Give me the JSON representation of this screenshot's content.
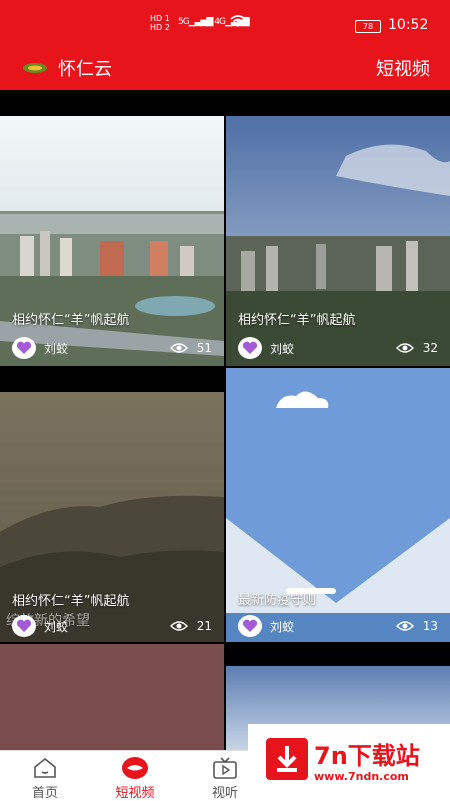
{
  "status_bar": {
    "signal_text_1": "HD 1",
    "signal_text_2": "HD 2",
    "network": "5G",
    "network2": "4G",
    "battery": "78",
    "time": "10:52"
  },
  "header": {
    "app_title": "怀仁云",
    "section_title": "短视频",
    "accent_color": "#e8141c"
  },
  "videos": [
    {
      "caption": "相约怀仁“羊”帆起航",
      "author": "刘蛟",
      "views": "51",
      "avatar_icon": "heart-icon"
    },
    {
      "caption": "相约怀仁“羊”帆起航",
      "author": "刘蛟",
      "views": "32",
      "avatar_icon": "heart-icon"
    },
    {
      "caption": "相约怀仁“羊”帆起航",
      "author": "刘蛟",
      "views": "21",
      "overlay": "绽放新的希望",
      "avatar_icon": "heart-icon"
    },
    {
      "caption": "最新防疫守则",
      "author": "刘蛟",
      "views": "13",
      "avatar_icon": "heart-icon"
    }
  ],
  "bottom_nav": [
    {
      "label": "首页",
      "icon": "home-icon"
    },
    {
      "label": "短视频",
      "icon": "lips-icon",
      "active": true
    },
    {
      "label": "视听",
      "icon": "tv-play-icon"
    }
  ],
  "watermark": {
    "title": "7n下载站",
    "url": "www.7ndn.com"
  }
}
